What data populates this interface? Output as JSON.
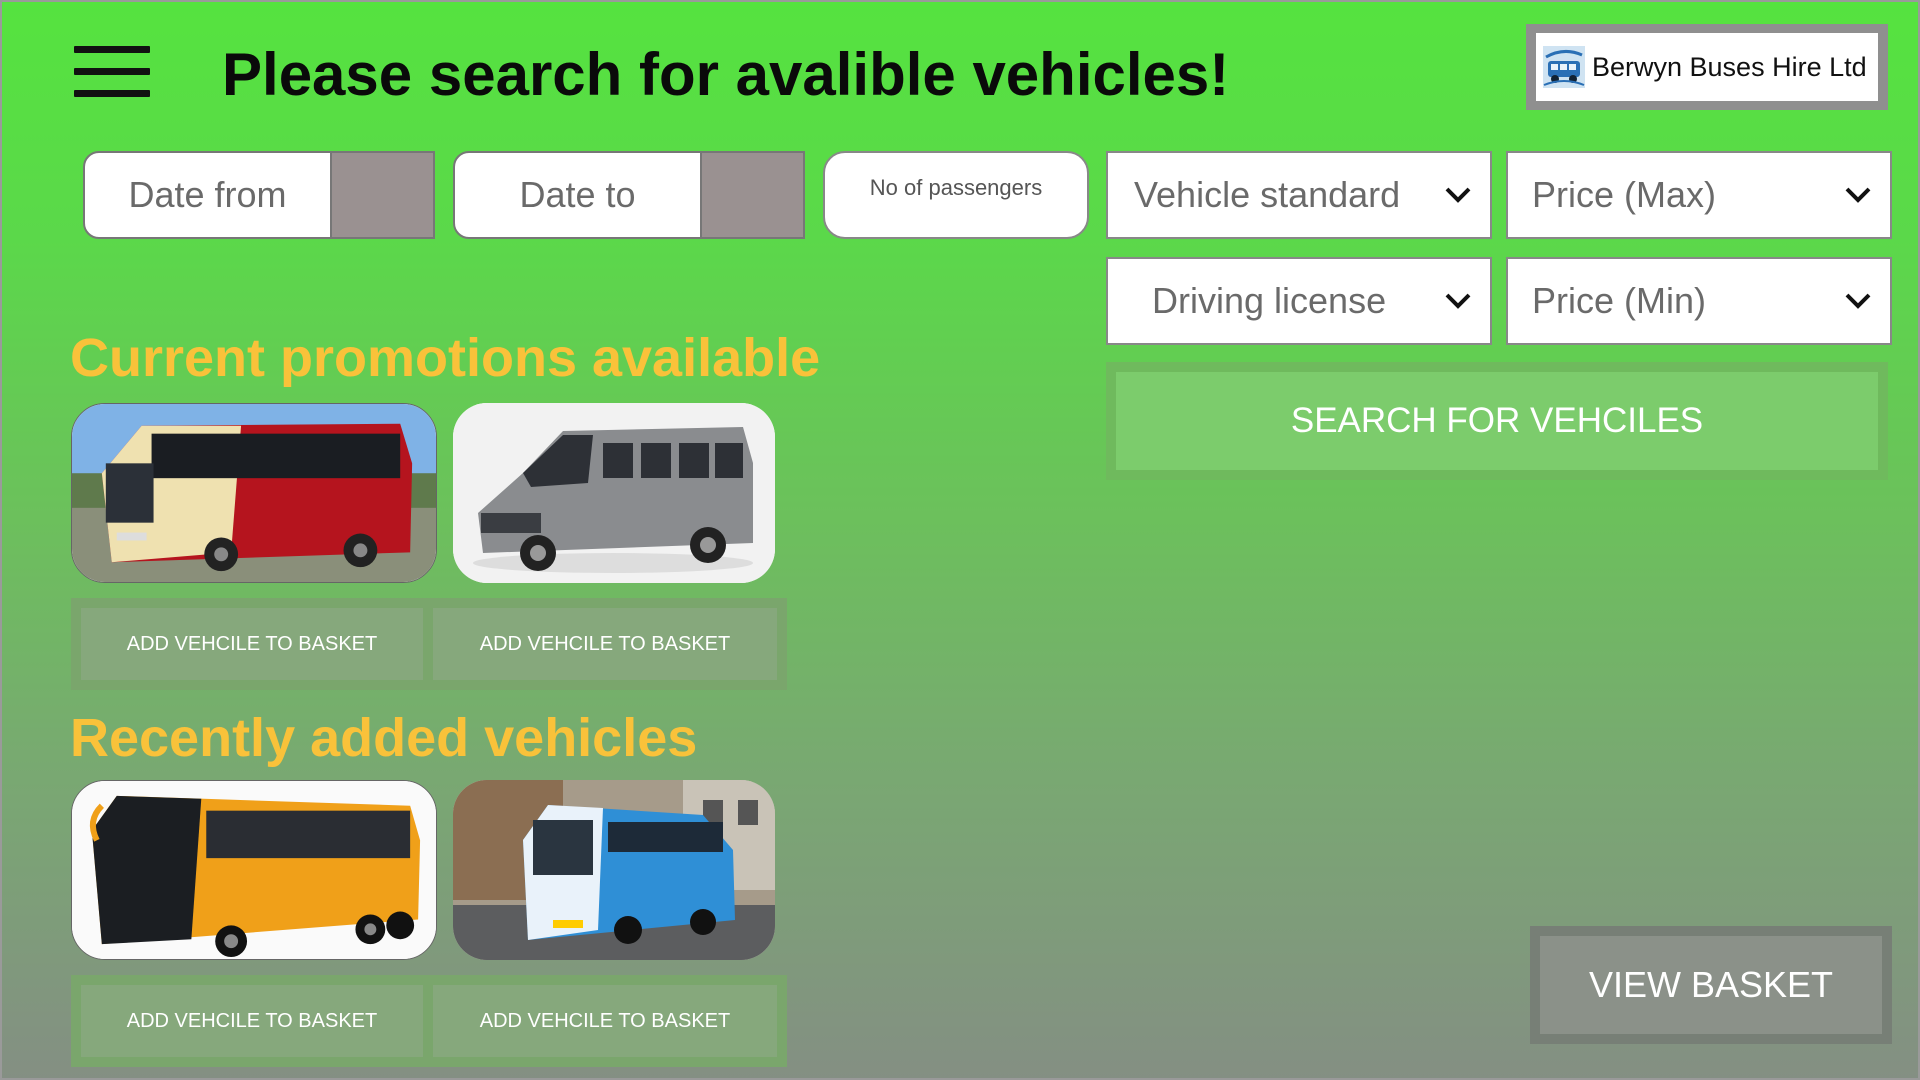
{
  "header": {
    "title": "Please search for avalible vehicles!",
    "menu_icon": "hamburger-menu-icon",
    "logo_text": "Berwyn Buses Hire Ltd",
    "logo_icon": "bus-logo-icon"
  },
  "filters": {
    "date_from": {
      "placeholder": "Date from"
    },
    "date_to": {
      "placeholder": "Date to"
    },
    "passengers": {
      "placeholder": "No of passengers"
    },
    "vehicle_standard": {
      "value": "Vehicle standard"
    },
    "price_max": {
      "value": "Price (Max)"
    },
    "driving_license": {
      "value": "Driving license"
    },
    "price_min": {
      "value": "Price (Min)"
    },
    "search_button": "SEARCH FOR VEHCILES"
  },
  "promotions": {
    "title": "Current promotions available",
    "items": [
      {
        "image": "red-cream-coach-photo",
        "button": "ADD VEHCILE TO BASKET"
      },
      {
        "image": "grey-minibus-photo",
        "button": "ADD VEHCILE TO BASKET"
      }
    ]
  },
  "recent": {
    "title": "Recently added vehicles",
    "items": [
      {
        "image": "orange-coach-photo",
        "button": "ADD VEHCILE TO BASKET"
      },
      {
        "image": "blue-coach-street-photo",
        "button": "ADD VEHCILE TO BASKET"
      }
    ]
  },
  "view_basket": "VIEW BASKET",
  "colors": {
    "background_top": "#55e33f",
    "background_bottom": "#848f83",
    "section_title": "#f9c23a",
    "search_button": "#7ccc6c"
  }
}
